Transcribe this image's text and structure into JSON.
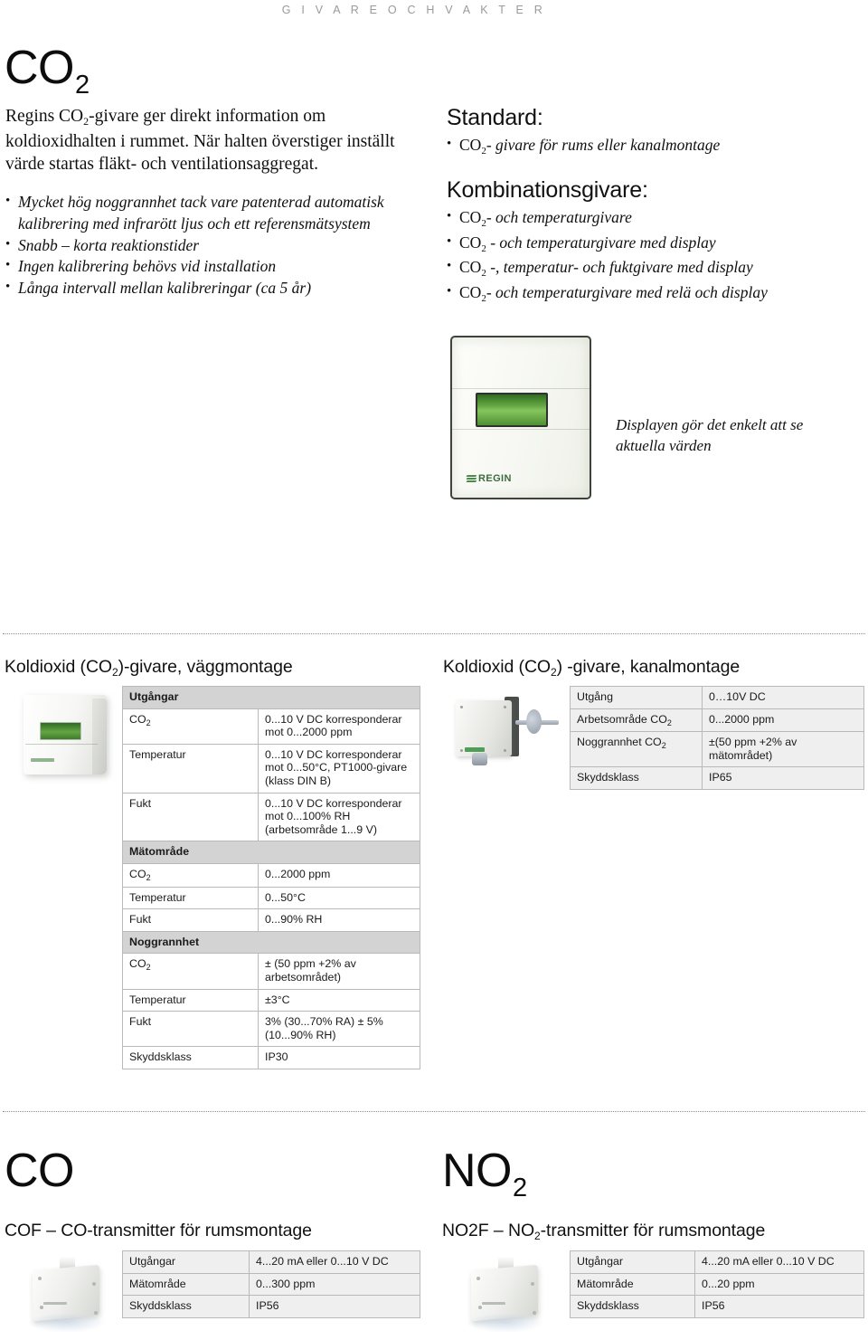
{
  "running_header": "G I V A R E   O C H   V A K T E R",
  "hero": {
    "title_main": "CO",
    "title_sub": "2",
    "intro_part1": "Regins CO",
    "intro_sub": "2",
    "intro_part2": "-givare ger direkt information om koldioxidhalten i rummet. När halten överstiger inställt värde startas fläkt- och ventilationsaggregat.",
    "features": [
      "Mycket hög noggrannhet tack vare patenterad automatisk kalibrering med infrarött ljus och ett referensmätsystem",
      "Snabb – korta reaktionstider",
      "Ingen kalibrering behövs vid installation",
      "Långa intervall mellan kalibreringar (ca 5 år)"
    ],
    "standard_heading": "Standard:",
    "standard_items": [
      {
        "formula": "CO",
        "sub": "2",
        "text": "- givare för rums eller kanalmontage"
      }
    ],
    "kombi_heading": "Kombinationsgivare:",
    "kombi_items": [
      {
        "formula": "CO",
        "sub": "2",
        "text": "- och temperaturgivare"
      },
      {
        "formula": "CO",
        "sub": "2",
        "text": " - och temperaturgivare med display"
      },
      {
        "formula": "CO",
        "sub": "2",
        "text": " -, temperatur- och fuktgivare med display"
      },
      {
        "formula": "CO",
        "sub": "2",
        "text": "- och temperaturgivare med relä och display"
      }
    ],
    "device_logo": "REGIN",
    "caption": "Displayen gör det enkelt att se aktuella värden"
  },
  "wall_section": {
    "heading_before": "Koldioxid (CO",
    "heading_sub": "2",
    "heading_after": ")-givare, väggmontage",
    "rows": [
      {
        "type": "group",
        "label": "Utgångar"
      },
      {
        "type": "data",
        "key": "CO",
        "key_sub": "2",
        "value": "0...10 V DC korresponderar mot 0...2000 ppm"
      },
      {
        "type": "data",
        "key": "Temperatur",
        "value": "0...10 V DC korresponderar mot 0...50°C, PT1000-givare (klass DIN B)"
      },
      {
        "type": "data",
        "key": "Fukt",
        "value": "0...10 V DC korresponderar mot 0...100% RH (arbetsområde 1...9 V)"
      },
      {
        "type": "group",
        "label": "Mätområde"
      },
      {
        "type": "data",
        "key": "CO",
        "key_sub": "2",
        "value": "0...2000 ppm"
      },
      {
        "type": "data",
        "key": "Temperatur",
        "value": "0...50°C"
      },
      {
        "type": "data",
        "key": "Fukt",
        "value": "0...90% RH"
      },
      {
        "type": "group",
        "label": "Noggrannhet"
      },
      {
        "type": "data",
        "key": "CO",
        "key_sub": "2",
        "value": "± (50 ppm +2% av arbetsområdet)"
      },
      {
        "type": "data",
        "key": "Temperatur",
        "value": "±3°C"
      },
      {
        "type": "data",
        "key": "Fukt",
        "value": "3% (30...70% RA) ± 5% (10...90% RH)"
      },
      {
        "type": "data",
        "key": "Skyddsklass",
        "value": "IP30"
      }
    ]
  },
  "duct_section": {
    "heading_before": "Koldioxid (CO",
    "heading_sub": "2",
    "heading_after": ") -givare, kanalmontage",
    "rows": [
      {
        "type": "data",
        "key": "Utgång",
        "value": "0…10V DC"
      },
      {
        "type": "data",
        "key": "Arbetsområde CO",
        "key_sub": "2",
        "value": "0...2000 ppm"
      },
      {
        "type": "data",
        "key": "Noggrannhet CO",
        "key_sub": "2",
        "value": "±(50 ppm +2% av mätområdet)"
      },
      {
        "type": "data",
        "key": "Skyddsklass",
        "value": "IP65"
      }
    ]
  },
  "co_section": {
    "title_main": "CO",
    "heading": "COF – CO-transmitter för rumsmontage",
    "rows": [
      {
        "type": "data",
        "key": "Utgångar",
        "value": "4...20 mA eller 0...10 V DC"
      },
      {
        "type": "data",
        "key": "Mätområde",
        "value": "0...300 ppm"
      },
      {
        "type": "data",
        "key": "Skyddsklass",
        "value": "IP56"
      }
    ]
  },
  "no2_section": {
    "title_main": "NO",
    "title_sub": "2",
    "heading_before": "NO2F – NO",
    "heading_sub": "2",
    "heading_after": "-transmitter för rumsmontage",
    "rows": [
      {
        "type": "data",
        "key": "Utgångar",
        "value": "4...20 mA eller 0...10 V DC"
      },
      {
        "type": "data",
        "key": "Mätområde",
        "value": "0...20 ppm"
      },
      {
        "type": "data",
        "key": "Skyddsklass",
        "value": "IP56"
      }
    ]
  },
  "colors": {
    "group_header_bg": "#d3d3d3",
    "shaded_row_bg": "#efefef",
    "table_border": "#b9b9b9",
    "running_header_text": "#9a9a9a",
    "lcd_green": "#63a543",
    "logo_green": "#4d8a4d"
  }
}
